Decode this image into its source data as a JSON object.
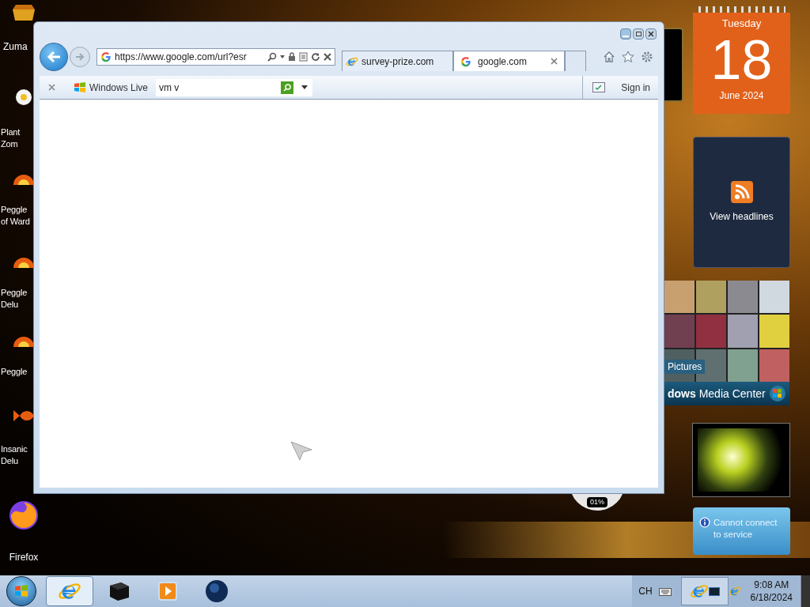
{
  "desktop_icons": [
    {
      "kind": "zuma",
      "lines": [
        "Zuma"
      ]
    },
    {
      "kind": "flower",
      "lines": [
        "Plant",
        "Zom"
      ]
    },
    {
      "kind": "peggle",
      "lines": [
        "Peggle",
        "of Ward"
      ]
    },
    {
      "kind": "peggle",
      "lines": [
        "Peggle",
        "Delu"
      ]
    },
    {
      "kind": "peggle",
      "lines": [
        "Peggle"
      ]
    },
    {
      "kind": "fish",
      "lines": [
        "Insanic",
        "Delu"
      ]
    },
    {
      "kind": "firefox",
      "lines": [
        "Firefox"
      ]
    }
  ],
  "gadgets": {
    "calendar": {
      "weekday": "Tuesday",
      "day": "18",
      "month_year": "June 2024"
    },
    "feed": {
      "label": "View headlines"
    },
    "media_center": {
      "section": "Pictures",
      "title_bold": "dows",
      "title": "Media Center"
    },
    "gauge": {
      "reading": "01%"
    },
    "weather": {
      "message": "Cannot connect to service"
    }
  },
  "browser": {
    "address": "https://www.google.com/url?esr",
    "tabs": [
      {
        "label": "survey-prize.com",
        "kind": "ie",
        "selected": false
      },
      {
        "label": "google.com",
        "kind": "google",
        "selected": true
      }
    ],
    "toolbar": {
      "brand": "Windows Live",
      "search_value": "vm v",
      "sign_in": "Sign in"
    }
  },
  "taskbar": {
    "items": [
      {
        "kind": "ie",
        "active": true
      },
      {
        "kind": "box",
        "active": false
      },
      {
        "kind": "player",
        "active": false
      },
      {
        "kind": "globe",
        "active": false
      }
    ],
    "language": "CH",
    "time": "9:08 AM",
    "date": "6/18/2024"
  }
}
